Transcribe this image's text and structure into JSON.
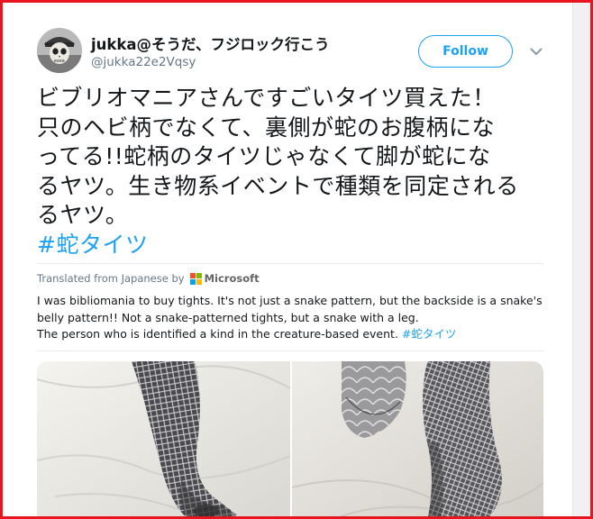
{
  "user": {
    "display_name": "jukka@そうだ、フジロック行こう",
    "handle": "@jukka22e2Vqsy"
  },
  "follow_label": "Follow",
  "tweet": {
    "lines": [
      "ビブリオマニアさんですごいタイツ買えた！",
      "只のヘビ柄でなくて、裏側が蛇のお腹柄にな",
      "ってる!!蛇柄のタイツじゃなくて脚が蛇にな",
      "るヤツ。生き物系イベントで種類を同定される",
      "るヤツ。"
    ],
    "hashtag": "#蛇タイツ"
  },
  "translation": {
    "by_label": "Translated from Japanese by",
    "provider": "Microsoft",
    "lines": [
      "I was bibliomania to buy tights. It's not just a snake pattern, but the backside is a snake's",
      "belly pattern!! Not a snake-patterned tights, but a snake with a leg.",
      "The person who is identified a kind in the creature-based event."
    ],
    "hashtag": "#蛇タイツ"
  },
  "colors": {
    "accent": "#1da1f2",
    "frame_border": "#e8141f",
    "text": "#14171a",
    "muted": "#657786",
    "ms_red": "#f25022",
    "ms_green": "#7fba00",
    "ms_blue": "#00a4ef",
    "ms_yellow": "#ffb900"
  },
  "icons": {
    "caret": "chevron-down-icon",
    "avatar": "skull-avatar"
  }
}
